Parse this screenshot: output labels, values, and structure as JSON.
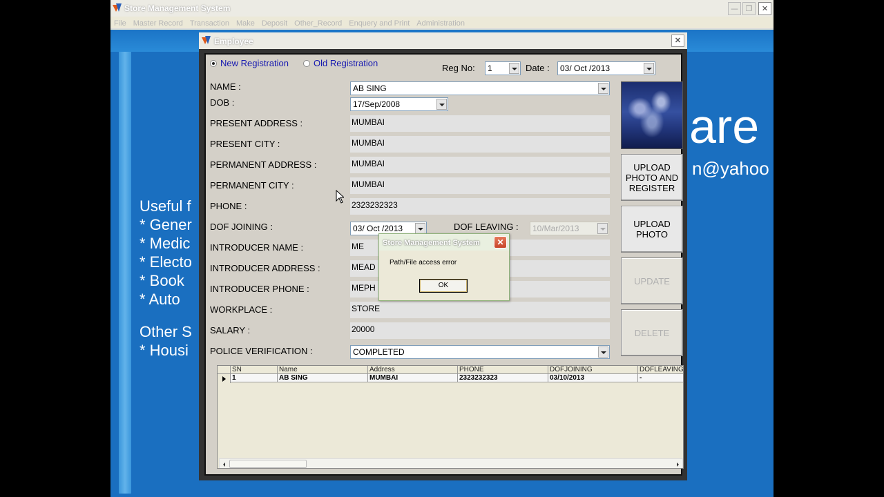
{
  "main_window": {
    "title": "Store Management System",
    "menu": [
      "File",
      "Master Record",
      "Transaction",
      "Make",
      "Deposit",
      "Other_Record",
      "Enquery and Print",
      "Administration"
    ]
  },
  "background": {
    "logo_text": "are",
    "email_text": "n@yahoo",
    "lines": [
      "Useful f",
      "* Gener",
      "* Medic",
      "* Electo",
      "* Book",
      "* Auto",
      "Other S",
      "* Housi"
    ]
  },
  "employee_window": {
    "title": "Employee",
    "radios": {
      "new_label": "New Registration",
      "old_label": "Old Registration",
      "selected": "new"
    },
    "reg_no": {
      "label": "Reg No:",
      "value": "1"
    },
    "date": {
      "label": "Date :",
      "value": "03/ Oct /2013"
    },
    "labels": {
      "name": "NAME :",
      "dob": "DOB :",
      "present_address": "PRESENT ADDRESS :",
      "present_city": "PRESENT CITY :",
      "permanent_address": "PERMANENT ADDRESS :",
      "permanent_city": "PERMANENT CITY :",
      "phone": "PHONE :",
      "dof_joining": "DOF JOINING :",
      "dof_leaving": "DOF LEAVING :",
      "introducer_name": "INTRODUCER NAME :",
      "introducer_address": "INTRODUCER ADDRESS :",
      "introducer_phone": "INTRODUCER PHONE :",
      "workplace": "WORKPLACE :",
      "salary": "SALARY :",
      "police_verification": "POLICE VERIFICATION :"
    },
    "values": {
      "name": "AB SING",
      "dob": "17/Sep/2008",
      "present_address": "MUMBAI",
      "present_city": "MUMBAI",
      "permanent_address": "MUMBAI",
      "permanent_city": "MUMBAI",
      "phone": "2323232323",
      "dof_joining": "03/ Oct /2013",
      "dof_leaving": "10/Mar/2013",
      "introducer_name": "ME",
      "introducer_address": "MEAD",
      "introducer_phone": "MEPH",
      "workplace": "STORE",
      "salary": "20000",
      "police_verification": "COMPLETED"
    },
    "buttons": {
      "upload_register": "UPLOAD PHOTO AND REGISTER",
      "upload_photo": "UPLOAD PHOTO",
      "update": "UPDATE",
      "delete": "DELETE"
    },
    "grid": {
      "columns": [
        "SN",
        "Name",
        "Address",
        "PHONE",
        "DOFJOINING",
        "DOFLEAVING"
      ],
      "rows": [
        [
          "1",
          "AB SING",
          "MUMBAI",
          "2323232323",
          "03/10/2013",
          "-"
        ]
      ]
    }
  },
  "message_box": {
    "title": "Store Management System",
    "text": "Path/File access error",
    "ok_label": "OK"
  }
}
